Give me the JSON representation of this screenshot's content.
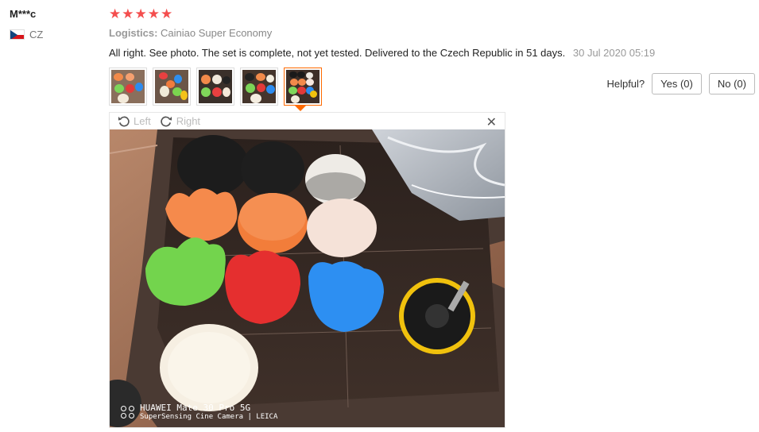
{
  "review": {
    "user": "M***c",
    "country": "CZ",
    "rating": 5,
    "stars": "★★★★★",
    "logistics_label": "Logistics:",
    "logistics_value": "Cainiao Super Economy",
    "text": "All right. See photo. The set is complete, not yet tested. Delivered to the Czech Republic in 51 days.",
    "date": "30 Jul 2020 05:19"
  },
  "feedback": {
    "helpful_label": "Helpful?",
    "yes_label": "Yes (0)",
    "no_label": "No (0)"
  },
  "viewer": {
    "left_label": "Left",
    "right_label": "Right",
    "close_glyph": "✕",
    "watermark_line1": "HUAWEI Mate 30 Pro 5G",
    "watermark_line2": "SuperSensing Cine Camera | LEICA",
    "active_thumbnail": 5
  },
  "thumbnail_count": 5,
  "colors": {
    "stars": "#f44e4e",
    "active_border": "#ff6a00",
    "flag_white": "#ffffff",
    "flag_red": "#d7141a",
    "flag_blue": "#11457e"
  }
}
